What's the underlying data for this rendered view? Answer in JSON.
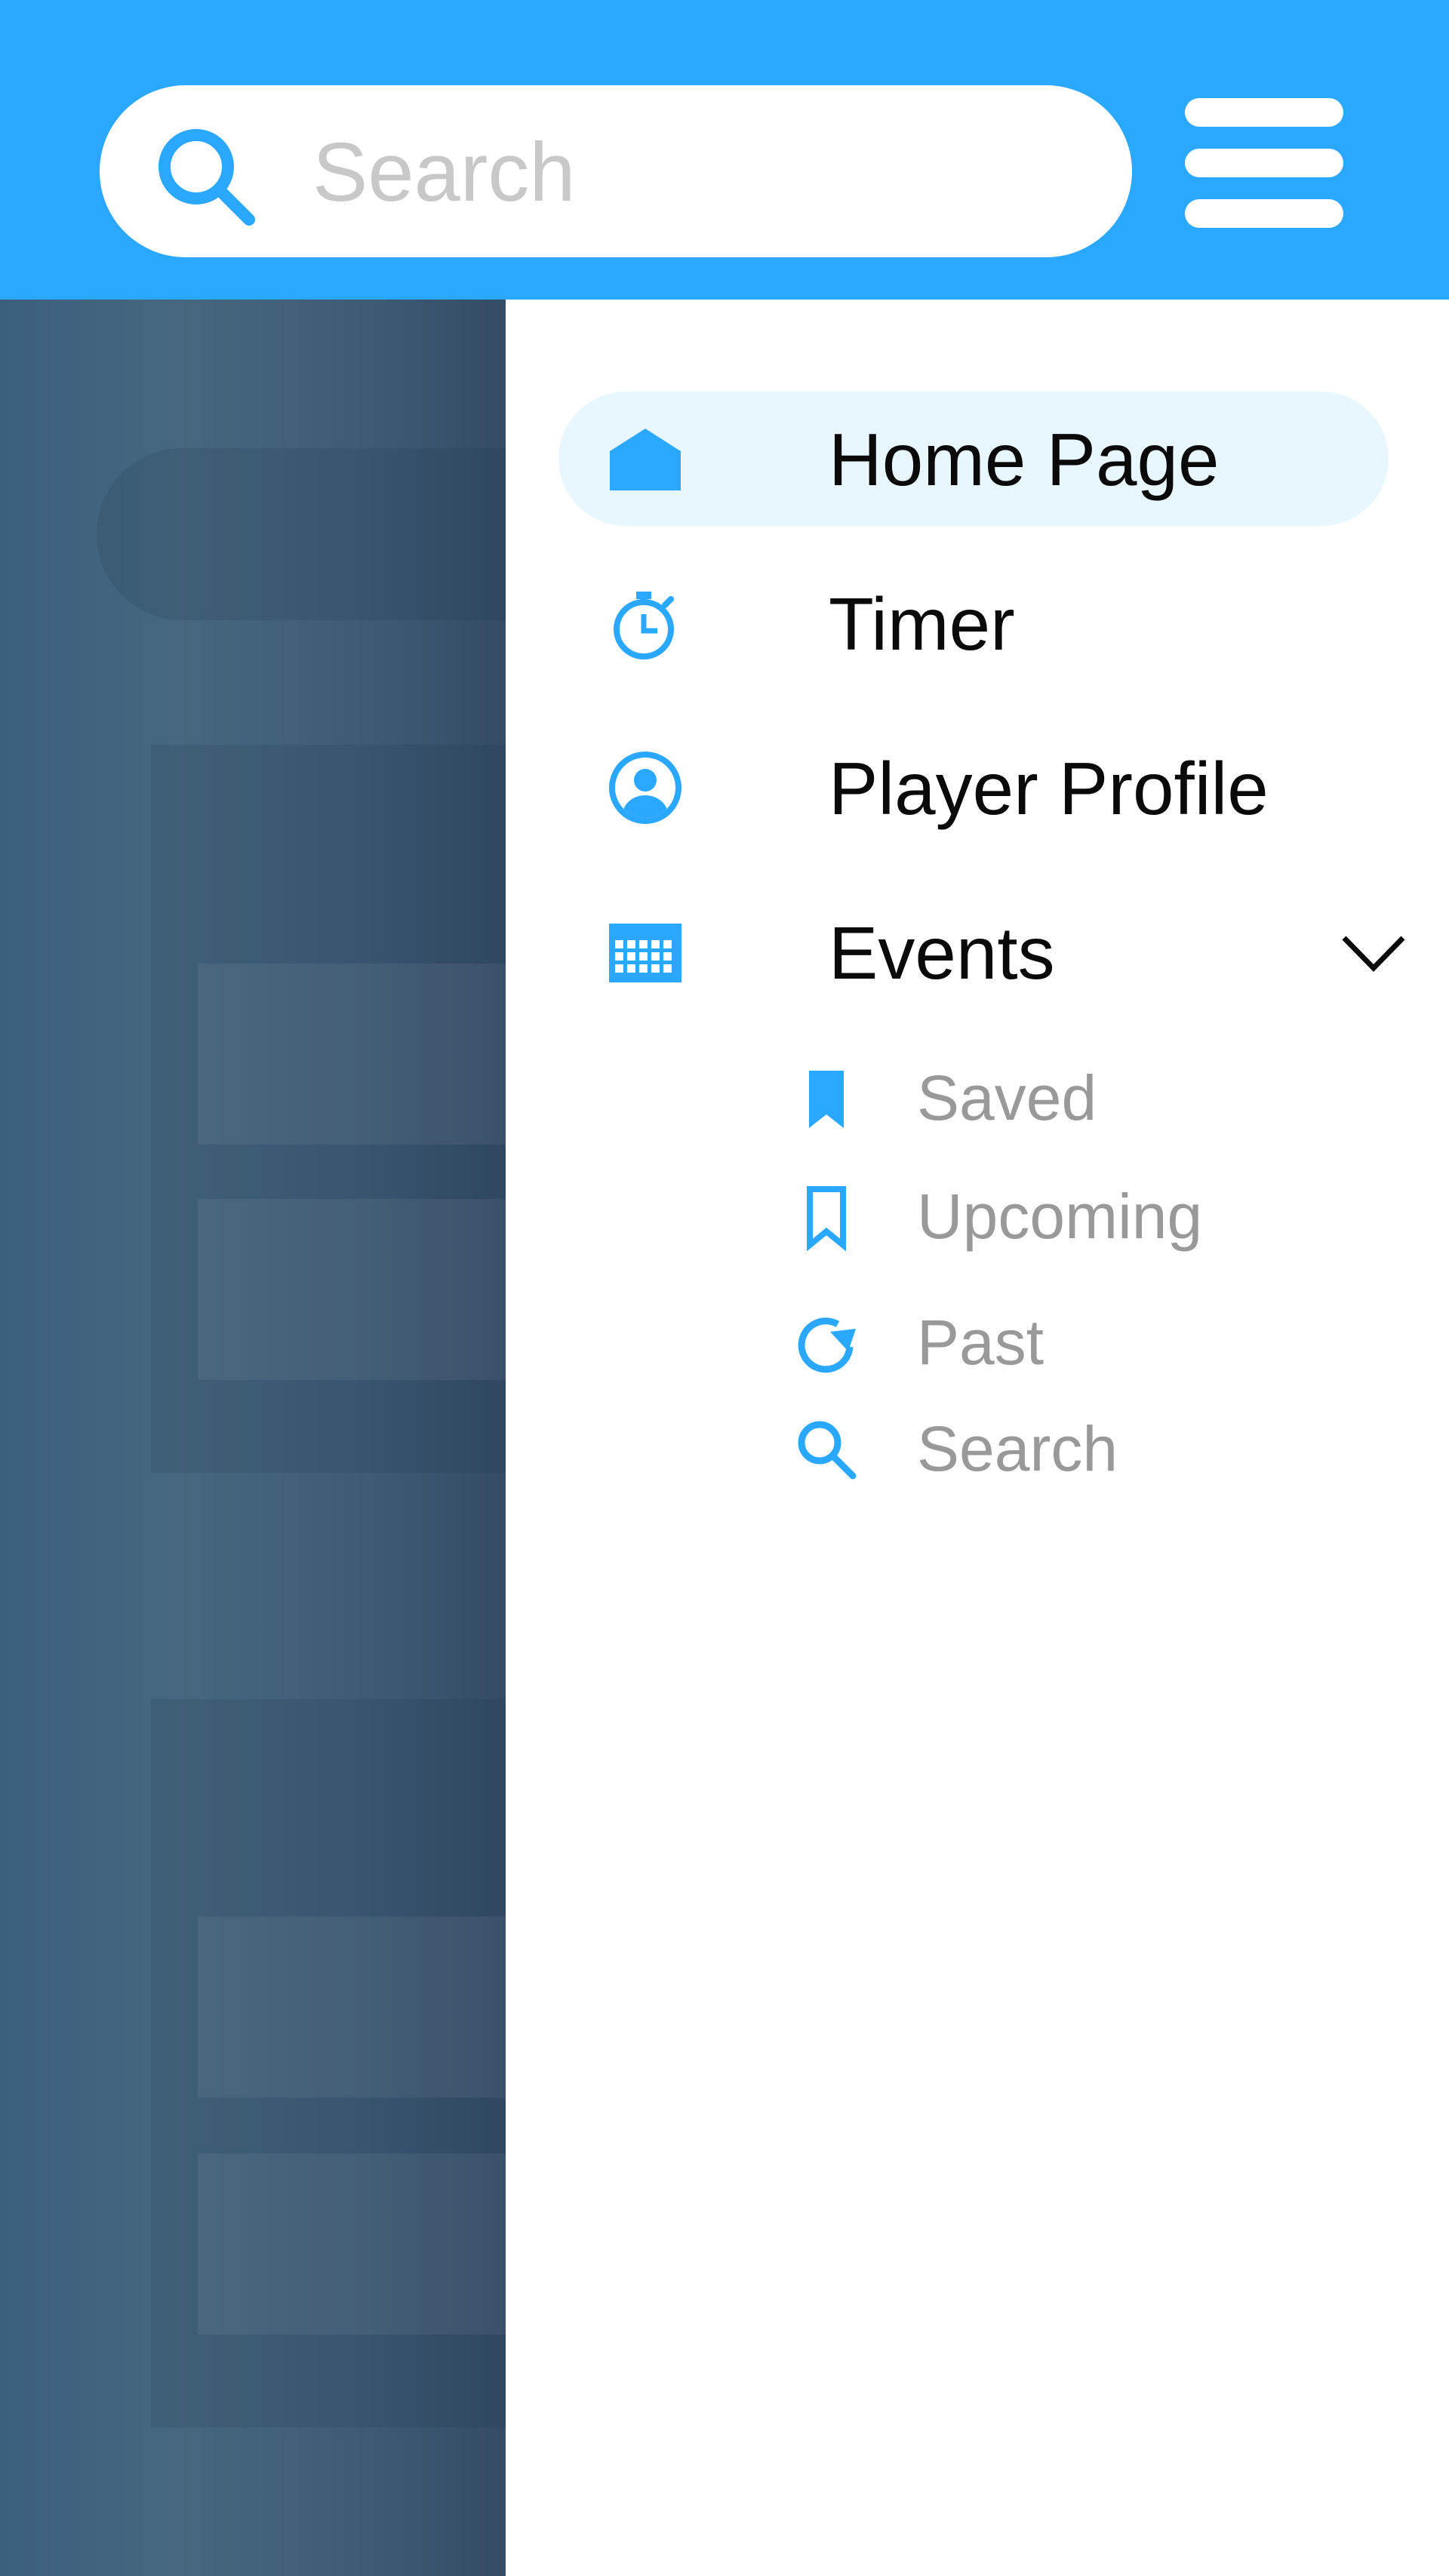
{
  "colors": {
    "accent": "#2aa8ff",
    "highlight": "#e8f7fd",
    "muted_text": "#999999"
  },
  "search": {
    "placeholder": "Search",
    "value": ""
  },
  "menu": {
    "items": [
      {
        "label": "Home Page",
        "icon": "home-icon",
        "active": true
      },
      {
        "label": "Timer",
        "icon": "stopwatch-icon"
      },
      {
        "label": "Player Profile",
        "icon": "user-circle-icon"
      },
      {
        "label": "Events",
        "icon": "calendar-icon",
        "expanded": true
      }
    ],
    "events_submenu": [
      {
        "label": "Saved",
        "icon": "bookmark-filled-icon"
      },
      {
        "label": "Upcoming",
        "icon": "bookmark-outline-icon"
      },
      {
        "label": "Past",
        "icon": "refresh-icon"
      },
      {
        "label": "Search",
        "icon": "search-icon"
      }
    ]
  }
}
